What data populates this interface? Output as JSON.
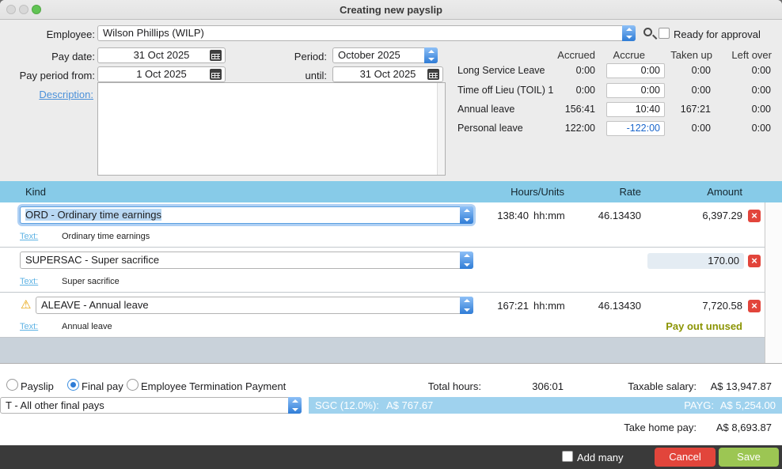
{
  "window": {
    "title": "Creating new payslip"
  },
  "colors": {
    "accent_blue": "#2f7cd6",
    "table_header_blue": "#87cbe8",
    "summary_bar_blue": "#9fd2ee",
    "cancel_red": "#e2453b",
    "save_green": "#9cc653",
    "note_olive": "#8b9404",
    "negative_blue": "#1a66cc"
  },
  "form": {
    "employee": {
      "label": "Employee:",
      "value": "Wilson Phillips (WILP)"
    },
    "ready_for_approval": {
      "label": "Ready for approval",
      "checked": false
    },
    "pay_date": {
      "label": "Pay date:",
      "value": "31 Oct 2025"
    },
    "period": {
      "label": "Period:",
      "value": "October 2025"
    },
    "pay_period_from": {
      "label": "Pay period from:",
      "value": "1 Oct 2025"
    },
    "until": {
      "label": "until:",
      "value": "31 Oct 2025"
    },
    "description": {
      "label": "Description:",
      "value": ""
    }
  },
  "leave_summary": {
    "columns": [
      "Accrued",
      "Accrue",
      "Taken up",
      "Left over"
    ],
    "rows": [
      {
        "name": "Long Service Leave",
        "accrued": "0:00",
        "accrue": "0:00",
        "taken_up": "0:00",
        "left_over": "0:00"
      },
      {
        "name": "Time off Lieu (TOIL) 1",
        "accrued": "0:00",
        "accrue": "0:00",
        "taken_up": "0:00",
        "left_over": "0:00"
      },
      {
        "name": "Annual leave",
        "accrued": "156:41",
        "accrue": "10:40",
        "taken_up": "167:21",
        "left_over": "0:00"
      },
      {
        "name": "Personal leave",
        "accrued": "122:00",
        "accrue": "-122:00",
        "taken_up": "0:00",
        "left_over": "0:00"
      }
    ]
  },
  "payslip_lines": {
    "headers": {
      "kind": "Kind",
      "hours_units": "Hours/Units",
      "rate": "Rate",
      "amount": "Amount"
    },
    "rows": [
      {
        "kind": "ORD - Ordinary time earnings",
        "hours": "138:40",
        "unit": "hh:mm",
        "rate": "46.13430",
        "amount": "6,397.29",
        "text_label": "Text:",
        "text_value": "Ordinary time earnings",
        "note": ""
      },
      {
        "kind": "SUPERSAC - Super sacrifice",
        "hours": "",
        "unit": "",
        "rate": "",
        "amount": "170.00",
        "text_label": "Text:",
        "text_value": "Super sacrifice",
        "note": ""
      },
      {
        "kind": "ALEAVE - Annual leave",
        "hours": "167:21",
        "unit": "hh:mm",
        "rate": "46.13430",
        "amount": "7,720.58",
        "text_label": "Text:",
        "text_value": "Annual leave",
        "note": "Pay out unused"
      }
    ]
  },
  "totals": {
    "payslip_type": {
      "options": [
        "Payslip",
        "Final pay",
        "Employee Termination Payment"
      ],
      "selected": "Final pay"
    },
    "total_hours": {
      "label": "Total hours:",
      "value": "306:01"
    },
    "taxable_salary": {
      "label": "Taxable salary:",
      "value": "A$ 13,947.87"
    },
    "final_pay_kind": "T - All other final pays",
    "sgc": {
      "label": "SGC (12.0%):",
      "value": "A$ 767.67"
    },
    "payg": {
      "label": "PAYG:",
      "value": "A$ 5,254.00"
    },
    "take_home": {
      "label": "Take home pay:",
      "value": "A$ 8,693.87"
    }
  },
  "footer": {
    "add_many": {
      "label": "Add many",
      "checked": false
    },
    "cancel": "Cancel",
    "save": "Save"
  }
}
